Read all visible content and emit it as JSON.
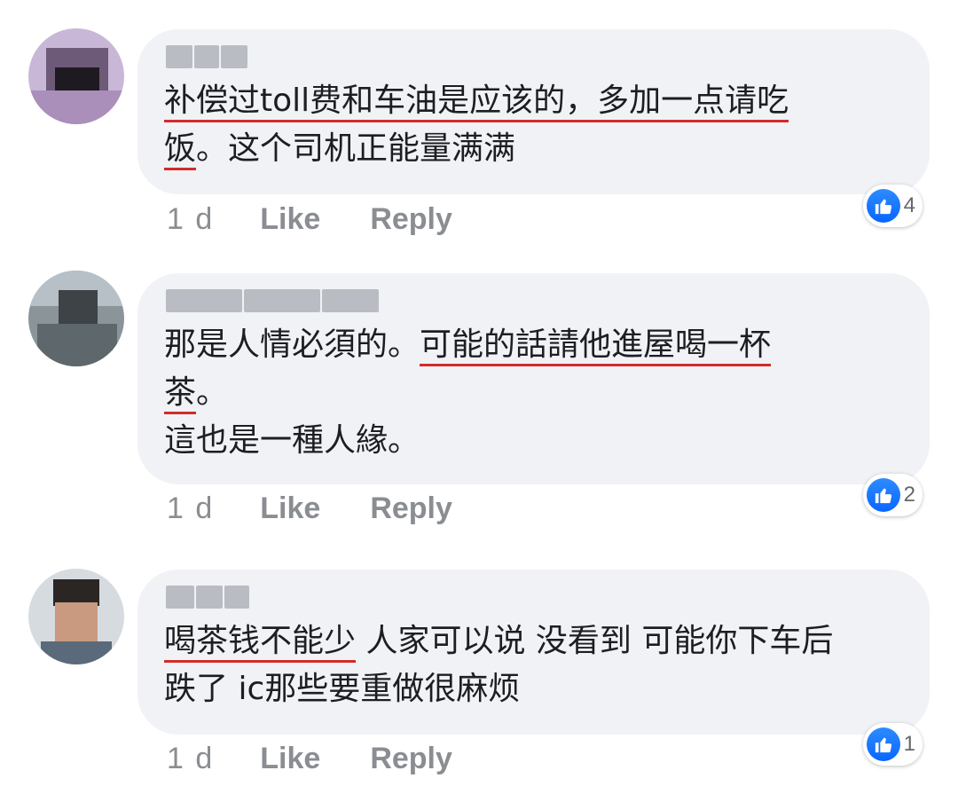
{
  "comments": [
    {
      "segments": [
        {
          "text": "补偿过toll费和车油是应该的，多加一点请吃",
          "ul": true
        },
        {
          "text": "\n",
          "ul": false
        },
        {
          "text": "饭",
          "ul": true
        },
        {
          "text": "。这个司机正能量满满",
          "ul": false
        }
      ],
      "time": "1 d",
      "like_label": "Like",
      "reply_label": "Reply",
      "reaction_count": "4"
    },
    {
      "segments": [
        {
          "text": "那是人情必須的。",
          "ul": false
        },
        {
          "text": "可能的話請他進屋喝一杯",
          "ul": true
        },
        {
          "text": "\n",
          "ul": false
        },
        {
          "text": "茶",
          "ul": true
        },
        {
          "text": "。\n這也是一種人緣。",
          "ul": false
        }
      ],
      "time": "1 d",
      "like_label": "Like",
      "reply_label": "Reply",
      "reaction_count": "2"
    },
    {
      "segments": [
        {
          "text": "喝茶钱不能少",
          "ul": true
        },
        {
          "text": " 人家可以说 没看到 可能你下车后\n跌了 ic那些要重做很麻烦",
          "ul": false
        }
      ],
      "time": "1 d",
      "like_label": "Like",
      "reply_label": "Reply",
      "reaction_count": "1"
    }
  ],
  "colors": {
    "bubble": "#f0f2f5",
    "underline": "#d32b2b",
    "like_blue": "#0866ff",
    "meta_gray": "#8a8d91"
  },
  "icons": {
    "reaction": "thumbs-up-icon",
    "avatar": "blurred-avatar-image"
  }
}
